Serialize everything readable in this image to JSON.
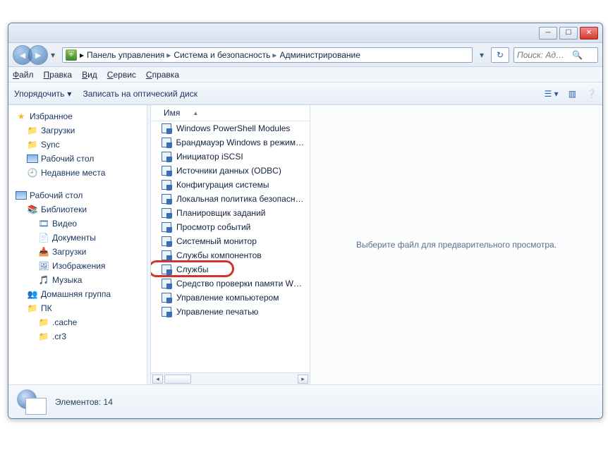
{
  "titlebar": {},
  "breadcrumb": {
    "items": [
      "Панель управления",
      "Система и безопасность",
      "Администрирование"
    ]
  },
  "search": {
    "placeholder": "Поиск: Ад…"
  },
  "menubar": {
    "file": {
      "label": "Файл",
      "ukey": "Ф"
    },
    "edit": {
      "label": "Правка",
      "ukey": "П"
    },
    "view": {
      "label": "Вид",
      "ukey": "В"
    },
    "tools": {
      "label": "Сервис",
      "ukey": "С"
    },
    "help": {
      "label": "Справка",
      "ukey": "С"
    }
  },
  "toolbar": {
    "organize": "Упорядочить",
    "burn": "Записать на оптический диск"
  },
  "sidebar": {
    "favorites_label": "Избранное",
    "favorites": {
      "items": [
        {
          "label": "Загрузки"
        },
        {
          "label": "Sync"
        },
        {
          "label": "Рабочий стол"
        },
        {
          "label": "Недавние места"
        }
      ]
    },
    "desktop_label": "Рабочий стол",
    "libraries_label": "Библиотеки",
    "libraries": {
      "items": [
        {
          "label": "Видео"
        },
        {
          "label": "Документы"
        },
        {
          "label": "Загрузки"
        },
        {
          "label": "Изображения"
        },
        {
          "label": "Музыка"
        }
      ]
    },
    "homegroup_label": "Домашняя группа",
    "pc_label": "ПК",
    "pc": {
      "items": [
        {
          "label": ".cache"
        },
        {
          "label": ".cr3"
        }
      ]
    }
  },
  "list": {
    "column_header": "Имя",
    "items": [
      {
        "label": "Windows PowerShell Modules"
      },
      {
        "label": "Брандмауэр Windows в режим…"
      },
      {
        "label": "Инициатор iSCSI"
      },
      {
        "label": "Источники данных (ODBC)"
      },
      {
        "label": "Конфигурация системы"
      },
      {
        "label": "Локальная политика безопасн…"
      },
      {
        "label": "Планировщик заданий"
      },
      {
        "label": "Просмотр событий"
      },
      {
        "label": "Системный монитор"
      },
      {
        "label": "Службы компонентов"
      },
      {
        "label": "Службы",
        "highlighted": true
      },
      {
        "label": "Средство проверки памяти W…"
      },
      {
        "label": "Управление компьютером"
      },
      {
        "label": "Управление печатью"
      }
    ]
  },
  "preview": {
    "message": "Выберите файл для предварительного просмотра."
  },
  "status": {
    "label": "Элементов:",
    "count": "14"
  }
}
